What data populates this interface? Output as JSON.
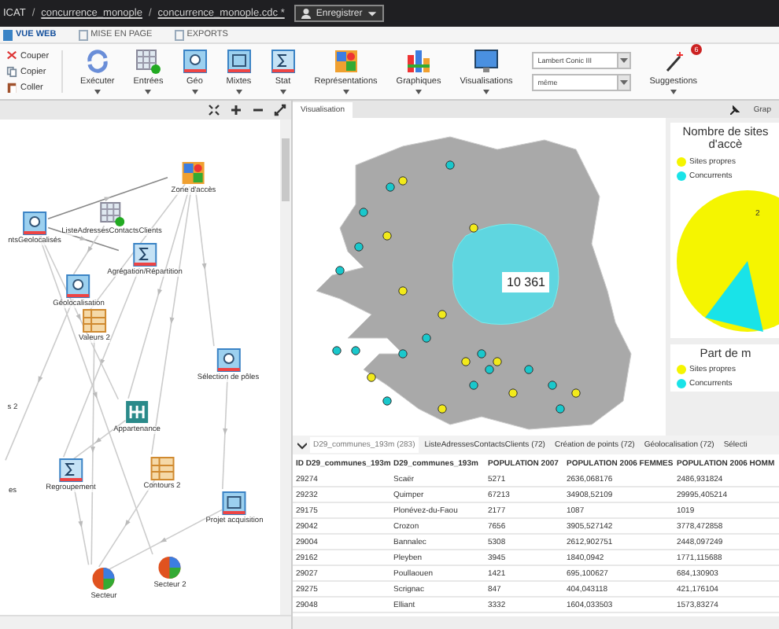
{
  "title_bar": {
    "app": "ICAT",
    "separator": "/",
    "path": [
      "concurrence_monople",
      "concurrence_monople.cdc *"
    ],
    "save_button": "Enregistrer"
  },
  "menu_tabs": [
    {
      "label": "VUE WEB",
      "selected": true
    },
    {
      "label": "MISE EN PAGE",
      "selected": false
    },
    {
      "label": "EXPORTS",
      "selected": false
    }
  ],
  "ribbon": {
    "clipboard": [
      {
        "label": "Couper",
        "kind": "cut"
      },
      {
        "label": "Copier",
        "kind": "copy"
      },
      {
        "label": "Coller",
        "kind": "paste"
      }
    ],
    "buttons": [
      {
        "label": "Exécuter",
        "kind": "refresh"
      },
      {
        "label": "Entrées",
        "kind": "table"
      },
      {
        "label": "Géo",
        "kind": "geo"
      },
      {
        "label": "Mixtes",
        "kind": "mixed"
      },
      {
        "label": "Stat",
        "kind": "stat"
      },
      {
        "label": "Représentations",
        "kind": "map"
      },
      {
        "label": "Graphiques",
        "kind": "chart"
      },
      {
        "label": "Visualisations",
        "kind": "monitor"
      }
    ],
    "projection": "Lambert Conic III",
    "scale": "même",
    "suggestions": {
      "label": "Suggestions",
      "badge": "6"
    }
  },
  "workflow": {
    "nodes": [
      {
        "label": "Zone d'accès",
        "kind": "map"
      },
      {
        "label": "ListeAdressesContactsClients",
        "kind": "table"
      },
      {
        "label": "ntsGeolocalisés",
        "kind": "geo"
      },
      {
        "label": "Agrégation/Répartition",
        "kind": "stat"
      },
      {
        "label": "Géolocalisation",
        "kind": "geo"
      },
      {
        "label": "Valeurs 2",
        "kind": "grid"
      },
      {
        "label": "Sélection de pôles",
        "kind": "geo"
      },
      {
        "label": "s 2",
        "kind": "none"
      },
      {
        "label": "Appartenance",
        "kind": "tree"
      },
      {
        "label": "es",
        "kind": "none"
      },
      {
        "label": "Regroupement",
        "kind": "stat"
      },
      {
        "label": "Contours 2",
        "kind": "grid"
      },
      {
        "label": "Projet acquisition",
        "kind": "mixed"
      },
      {
        "label": "Secteur",
        "kind": "pie"
      },
      {
        "label": "Secteur 2",
        "kind": "pie"
      }
    ]
  },
  "view_tabs": [
    {
      "label": "Visualisation",
      "selected": true
    },
    {
      "label": "Grap",
      "selected": false
    }
  ],
  "map": {
    "area_label": "10 361"
  },
  "charts": [
    {
      "title": "Nombre de sites d'accè",
      "legend": [
        {
          "label": "Sites propres",
          "color": "#f5f500"
        },
        {
          "label": "Concurrents",
          "color": "#19e3e8"
        }
      ],
      "pie_label": "2"
    },
    {
      "title": "Part de m",
      "legend": [
        {
          "label": "Sites propres",
          "color": "#f5f500"
        },
        {
          "label": "Concurrents",
          "color": "#19e3e8"
        }
      ]
    }
  ],
  "table_tabs": [
    {
      "label": "D29_communes_193m (283)",
      "selected": true
    },
    {
      "label": "ListeAdressesContactsClients (72)",
      "selected": false
    },
    {
      "label": "Création de points (72)",
      "selected": false
    },
    {
      "label": "Géolocalisation (72)",
      "selected": false
    },
    {
      "label": "Sélecti",
      "selected": false
    }
  ],
  "table": {
    "columns": [
      "ID D29_communes_193m",
      "D29_communes_193m",
      "POPULATION 2007",
      "POPULATION 2006 FEMMES",
      "POPULATION 2006 HOMM"
    ],
    "rows": [
      [
        "29274",
        "Scaër",
        "5271",
        "2636,068176",
        "2486,931824"
      ],
      [
        "29232",
        "Quimper",
        "67213",
        "34908,52109",
        "29995,405214"
      ],
      [
        "29175",
        "Plonévez-du-Faou",
        "2177",
        "1087",
        "1019"
      ],
      [
        "29042",
        "Crozon",
        "7656",
        "3905,527142",
        "3778,472858"
      ],
      [
        "29004",
        "Bannalec",
        "5308",
        "2612,902751",
        "2448,097249"
      ],
      [
        "29162",
        "Pleyben",
        "3945",
        "1840,0942",
        "1771,115688"
      ],
      [
        "29027",
        "Poullaouen",
        "1421",
        "695,100627",
        "684,130903"
      ],
      [
        "29275",
        "Scrignac",
        "847",
        "404,043118",
        "421,176104"
      ],
      [
        "29048",
        "Elliant",
        "3332",
        "1604,033503",
        "1573,83274"
      ]
    ]
  }
}
